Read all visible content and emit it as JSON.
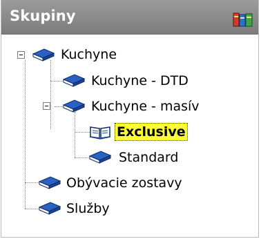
{
  "header": {
    "title": "Skupiny",
    "icon": "books-icon"
  },
  "tree": {
    "nodes": [
      {
        "label": "Kuchyne",
        "icon": "book-closed-icon",
        "expanded": true
      },
      {
        "label": "Kuchyne - DTD",
        "icon": "book-closed-icon"
      },
      {
        "label": "Kuchyne - masív",
        "icon": "book-closed-icon",
        "expanded": true
      },
      {
        "label": "Exclusive",
        "icon": "book-open-icon",
        "selected": true
      },
      {
        "label": "Standard",
        "icon": "book-closed-icon"
      },
      {
        "label": "Obývacie zostavy",
        "icon": "book-closed-icon"
      },
      {
        "label": "Služby",
        "icon": "book-closed-icon"
      }
    ]
  },
  "colors": {
    "header_bg": "#8a8a8a",
    "selected_bg": "#ffff33",
    "book_blue": "#1f4f9c"
  }
}
